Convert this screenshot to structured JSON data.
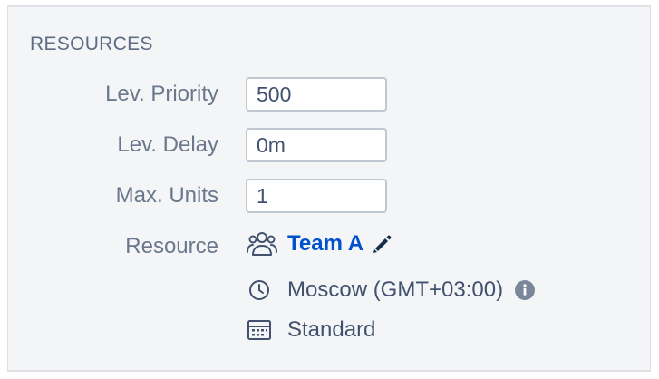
{
  "section": {
    "title": "RESOURCES"
  },
  "fields": {
    "lev_priority": {
      "label": "Lev. Priority",
      "value": "500"
    },
    "lev_delay": {
      "label": "Lev. Delay",
      "value": "0m"
    },
    "max_units": {
      "label": "Max. Units",
      "value": "1"
    }
  },
  "resource": {
    "label": "Resource",
    "team_name": "Team A",
    "timezone": "Moscow (GMT+03:00)",
    "calendar": "Standard",
    "icons": {
      "team": "team-icon",
      "edit": "pencil-icon",
      "clock": "clock-icon",
      "info": "info-icon",
      "calendar": "calendar-icon"
    }
  },
  "colors": {
    "accent": "#0052cc",
    "panel_bg": "#f4f5f7",
    "label": "#6b778c",
    "text": "#42526e"
  }
}
